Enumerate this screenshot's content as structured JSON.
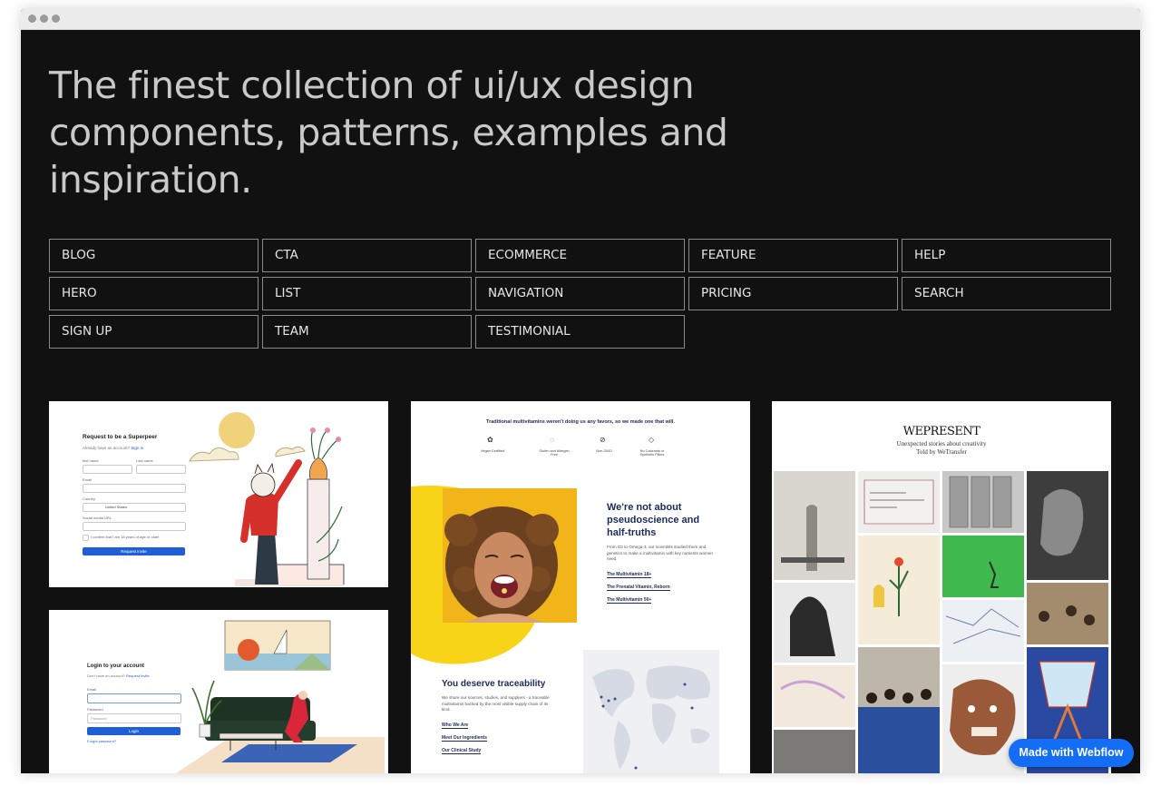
{
  "headline": "The finest collection of ui/ux design components, patterns, examples and inspiration.",
  "categories": [
    "BLOG",
    "CTA",
    "ECOMMERCE",
    "FEATURE",
    "HELP",
    "HERO",
    "LIST",
    "NAVIGATION",
    "PRICING",
    "SEARCH",
    "SIGN UP",
    "TEAM",
    "TESTIMONIAL"
  ],
  "card_signup": {
    "title": "Request to be a Superpeer",
    "subtitle": "Already have an account?",
    "subtitle_link": "Sign in",
    "first_name": "first name",
    "last_name": "Last name",
    "email": "Email",
    "country": "Country",
    "country_value": "United States",
    "social": "Social media URL",
    "confirm": "I confirm that I am 18 years of age or older",
    "button": "Request invite"
  },
  "card_login": {
    "title": "Login to your account",
    "subtitle": "Don't have an account?",
    "subtitle_link": "Request Invite",
    "email": "Email",
    "password": "Password",
    "password_placeholder": "Password",
    "button": "Login",
    "forgot": "Forgot password?"
  },
  "card_vitamins": {
    "tagline": "Traditional multivitamins weren't doing us any favors, so we made one that will.",
    "features": [
      "Vegan Certified",
      "Gluten and Allergen Free",
      "Non-GMO",
      "No Colorants or Synthetic Fillers"
    ],
    "heading": "We're not about pseudoscience and half-truths",
    "body": "From D3 to Omega-3, our scientists studied them and genetics to make a multivitamin with key nutrients women need.",
    "links": [
      "The Multivitamin 18+",
      "The Prenatal Vitamin, Reborn",
      "The Multivitamin 50+"
    ],
    "heading2": "You deserve traceability",
    "body2": "We share our sources, studies, and suppliers - a traceable multivitamin backed by the most visible supply chain of its kind.",
    "links2": [
      "Who We Are",
      "Meet Our Ingredients",
      "Our Clinical Study"
    ]
  },
  "card_wepresent": {
    "logo": "WEPRESENT",
    "line1": "Unexpected stories about creativity",
    "line2": "Told by WeTransfer"
  },
  "badge": "Made with Webflow",
  "colors": {
    "background": "#111111",
    "accent": "#146ef5",
    "yellow": "#f7d417"
  }
}
